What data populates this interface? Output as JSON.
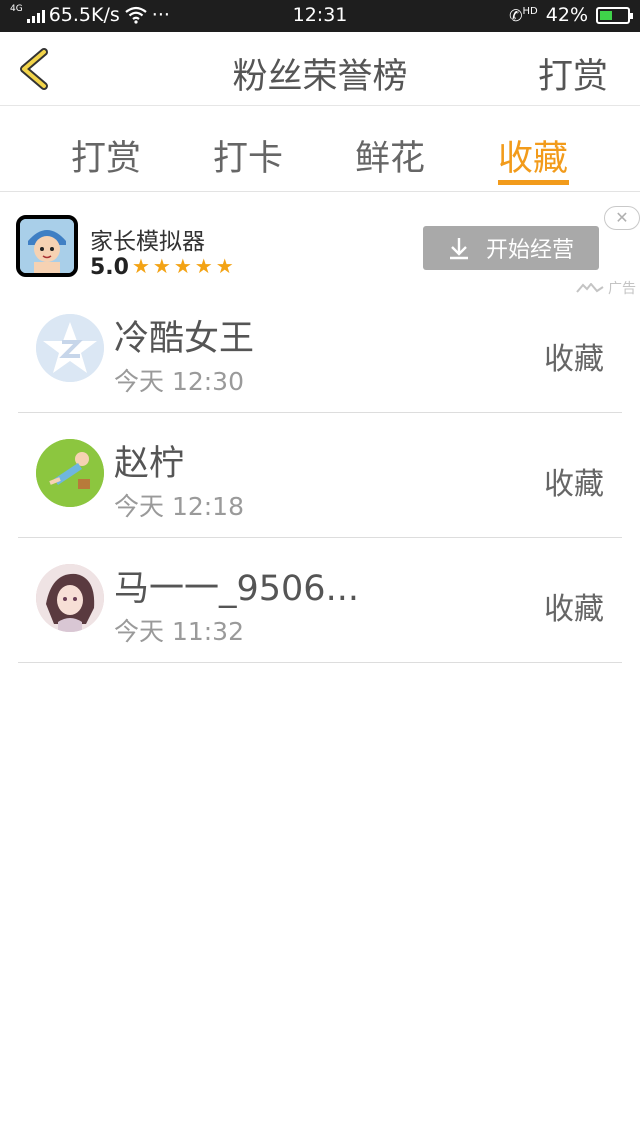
{
  "status_bar": {
    "network_type": "4G",
    "speed": "65.5K/s",
    "dots": "···",
    "time": "12:31",
    "call_label": "HD",
    "battery": "42%",
    "battery_level": 0.42
  },
  "nav": {
    "title": "粉丝荣誉榜",
    "action_label": "打赏"
  },
  "tabs": [
    {
      "label": "打赏",
      "active": false
    },
    {
      "label": "打卡",
      "active": false
    },
    {
      "label": "鲜花",
      "active": false
    },
    {
      "label": "收藏",
      "active": true
    }
  ],
  "ad": {
    "app_name": "家长模拟器",
    "rating": "5.0",
    "stars": "★★★★★",
    "button_label": "开始经营",
    "ad_tag": "广告",
    "close_symbol": "✕"
  },
  "entries": [
    {
      "name": "冷酷女王",
      "time": "今天 12:30",
      "type": "收藏",
      "avatar_color": "#dbe7f4"
    },
    {
      "name": "赵柠",
      "time": "今天 12:18",
      "type": "收藏",
      "avatar_color": "#8cc63f"
    },
    {
      "name": "马一一_9506...",
      "time": "今天 11:32",
      "type": "收藏",
      "avatar_color": "#e9cfd2"
    }
  ],
  "colors": {
    "accent": "#f29b1b",
    "status_bar_bg": "#1e1e1e",
    "ad_button": "#a9a9a9"
  }
}
